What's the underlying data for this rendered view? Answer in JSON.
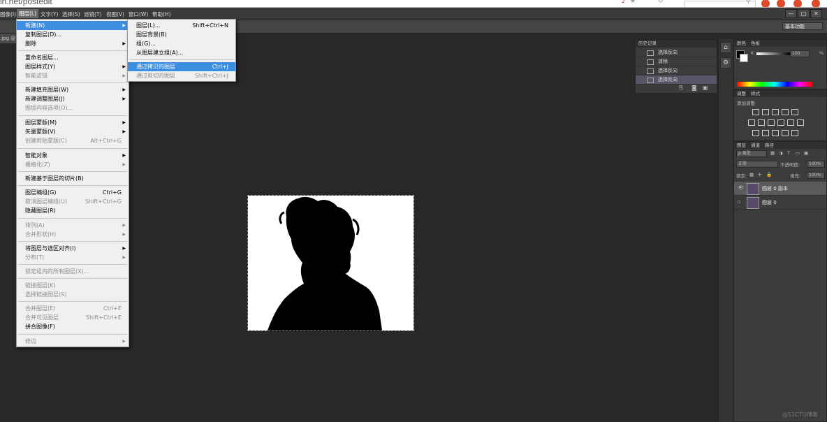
{
  "browser": {
    "url": "in.net/postedit",
    "badge": "2"
  },
  "menubar": {
    "items": [
      "图像(I)",
      "图层(L)",
      "文字(Y)",
      "选择(S)",
      "滤镜(T)",
      "视图(V)",
      "窗口(W)",
      "帮助(H)"
    ]
  },
  "window_controls": {
    "minimize": "—",
    "maximize": "□",
    "close": "✕"
  },
  "options_bar": {
    "workspace": "基本功能"
  },
  "document_tab": {
    "label": ".jpg @ 1"
  },
  "layer_menu": {
    "items": [
      {
        "label": "新建(N)",
        "shortcut": "",
        "submenu": true,
        "disabled": false,
        "highlighted": true
      },
      {
        "label": "复制图层(D)...",
        "shortcut": "",
        "submenu": false,
        "disabled": false
      },
      {
        "label": "删除",
        "shortcut": "",
        "submenu": true,
        "disabled": false
      },
      {
        "label": "重命名图层...",
        "shortcut": "",
        "submenu": false,
        "disabled": false
      },
      {
        "label": "图层样式(Y)",
        "shortcut": "",
        "submenu": true,
        "disabled": false
      },
      {
        "label": "智能滤镜",
        "shortcut": "",
        "submenu": true,
        "disabled": true
      },
      {
        "label": "新建填充图层(W)",
        "shortcut": "",
        "submenu": true,
        "disabled": false
      },
      {
        "label": "新建调整图层(J)",
        "shortcut": "",
        "submenu": true,
        "disabled": false
      },
      {
        "label": "图层内容选项(O)...",
        "shortcut": "",
        "submenu": false,
        "disabled": true
      },
      {
        "label": "图层蒙版(M)",
        "shortcut": "",
        "submenu": true,
        "disabled": false
      },
      {
        "label": "矢量蒙版(V)",
        "shortcut": "",
        "submenu": true,
        "disabled": false
      },
      {
        "label": "创建剪贴蒙版(C)",
        "shortcut": "Alt+Ctrl+G",
        "submenu": false,
        "disabled": true
      },
      {
        "label": "智能对象",
        "shortcut": "",
        "submenu": true,
        "disabled": false
      },
      {
        "label": "栅格化(Z)",
        "shortcut": "",
        "submenu": true,
        "disabled": true
      },
      {
        "label": "新建基于图层的切片(B)",
        "shortcut": "",
        "submenu": false,
        "disabled": false
      },
      {
        "label": "图层编组(G)",
        "shortcut": "Ctrl+G",
        "submenu": false,
        "disabled": false
      },
      {
        "label": "取消图层编组(U)",
        "shortcut": "Shift+Ctrl+G",
        "submenu": false,
        "disabled": true
      },
      {
        "label": "隐藏图层(R)",
        "shortcut": "",
        "submenu": false,
        "disabled": false
      },
      {
        "label": "排列(A)",
        "shortcut": "",
        "submenu": true,
        "disabled": true
      },
      {
        "label": "合并形状(H)",
        "shortcut": "",
        "submenu": true,
        "disabled": true
      },
      {
        "label": "将图层与选区对齐(I)",
        "shortcut": "",
        "submenu": true,
        "disabled": false
      },
      {
        "label": "分布(T)",
        "shortcut": "",
        "submenu": true,
        "disabled": true
      },
      {
        "label": "锁定组内的所有图层(X)...",
        "shortcut": "",
        "submenu": false,
        "disabled": true
      },
      {
        "label": "链接图层(K)",
        "shortcut": "",
        "submenu": false,
        "disabled": true
      },
      {
        "label": "选择链接图层(S)",
        "shortcut": "",
        "submenu": false,
        "disabled": true
      },
      {
        "label": "合并图层(E)",
        "shortcut": "Ctrl+E",
        "submenu": false,
        "disabled": true
      },
      {
        "label": "合并可见图层",
        "shortcut": "Shift+Ctrl+E",
        "submenu": false,
        "disabled": true
      },
      {
        "label": "拼合图像(F)",
        "shortcut": "",
        "submenu": false,
        "disabled": false
      },
      {
        "label": "修边",
        "shortcut": "",
        "submenu": true,
        "disabled": true
      }
    ]
  },
  "new_submenu": {
    "items": [
      {
        "label": "图层(L)...",
        "shortcut": "Shift+Ctrl+N",
        "disabled": false
      },
      {
        "label": "图层背景(B)",
        "shortcut": "",
        "disabled": false
      },
      {
        "label": "组(G)...",
        "shortcut": "",
        "disabled": false
      },
      {
        "label": "从图层建立组(A)...",
        "shortcut": "",
        "disabled": false
      },
      {
        "label": "通过拷贝的图层",
        "shortcut": "Ctrl+J",
        "disabled": false,
        "highlighted": true
      },
      {
        "label": "通过剪切的图层",
        "shortcut": "Shift+Ctrl+J",
        "disabled": true
      }
    ]
  },
  "history_panel": {
    "tab": "历史记录",
    "rows": [
      "选择反向",
      "清除",
      "选择反向",
      "选择反向"
    ]
  },
  "color_panel": {
    "tabs": [
      "颜色",
      "色板"
    ],
    "k_label": "K",
    "k_value": "100",
    "unit": "%"
  },
  "adjust_panel": {
    "tabs": [
      "调整",
      "样式"
    ],
    "title": "添加调整"
  },
  "layers_panel": {
    "tabs": [
      "图层",
      "通道",
      "路径"
    ],
    "filter": "ρ 类型",
    "blend_mode": "正常",
    "opacity_label": "不透明度:",
    "opacity_value": "100%",
    "lock_label": "锁定:",
    "fill_label": "填充:",
    "fill_value": "100%",
    "layers": [
      {
        "name": "图层 0 副本",
        "selected": true
      },
      {
        "name": "图层 0",
        "selected": false
      }
    ]
  },
  "watermark": "@51CTO博客"
}
